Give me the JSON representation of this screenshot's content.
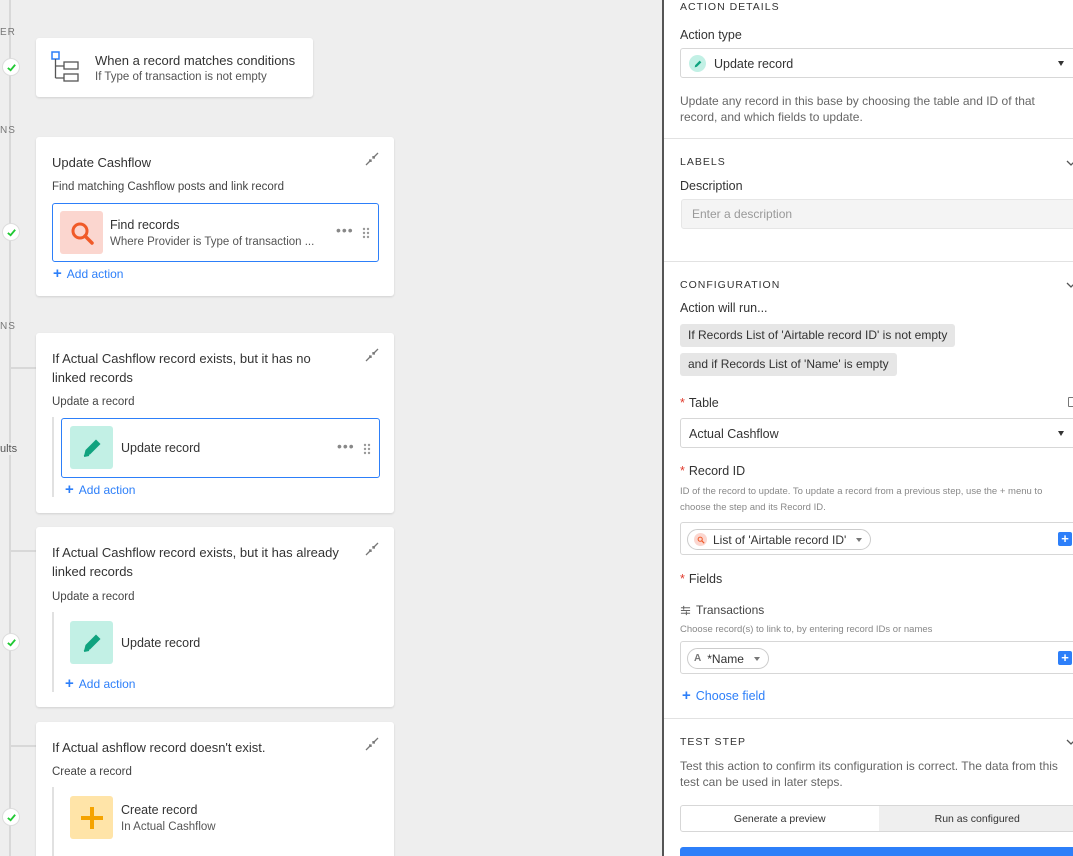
{
  "canvas": {
    "rail_labels": [
      "ER",
      "NS",
      "NS"
    ],
    "side_label_results": "ults",
    "trigger": {
      "title": "When a record matches conditions",
      "subtitle": "If Type of transaction is not empty"
    },
    "groups": [
      {
        "title": "Update Cashflow",
        "subtitle": "Find matching Cashflow posts and link record",
        "action": {
          "title": "Find records",
          "subtitle": "Where Provider is Type of transaction ...",
          "icon": "search-icon"
        },
        "add_action": "Add action"
      },
      {
        "title": "If Actual Cashflow record exists, but it has no linked records",
        "subtitle": "Update a record",
        "action": {
          "title": "Update record",
          "icon": "pencil-icon"
        },
        "add_action": "Add action"
      },
      {
        "title": "If Actual Cashflow record exists, but it has already linked records",
        "subtitle": "Update a record",
        "action": {
          "title": "Update record",
          "icon": "pencil-icon"
        },
        "add_action": "Add action"
      },
      {
        "title": "If Actual ashflow record doesn't exist.",
        "subtitle": "Create a record",
        "action": {
          "title": "Create record",
          "subtitle": "In Actual Cashflow",
          "icon": "plus-icon"
        },
        "add_action": "Add action"
      }
    ]
  },
  "panel": {
    "action_details": {
      "heading": "ACTION DETAILS",
      "action_type_label": "Action type",
      "action_type_value": "Update record",
      "description": "Update any record in this base by choosing the table and ID of that record, and which fields to update."
    },
    "labels": {
      "heading": "LABELS",
      "description_label": "Description",
      "description_placeholder": "Enter a description"
    },
    "configuration": {
      "heading": "CONFIGURATION",
      "will_run": "Action will run...",
      "conditions": [
        "If Records List of 'Airtable record ID' is not empty",
        "and if Records List of 'Name' is empty"
      ],
      "table_label": "Table",
      "table_value": "Actual Cashflow",
      "record_id_label": "Record ID",
      "record_id_help": "ID of the record to update. To update a record from a previous step, use the + menu to choose the step and its Record ID.",
      "record_id_token": "List of 'Airtable record ID'",
      "fields_label": "Fields",
      "field_name": "Transactions",
      "field_help": "Choose record(s) to link to, by entering record IDs or names",
      "field_token": "*Name",
      "choose_field": "Choose field"
    },
    "test_step": {
      "heading": "TEST STEP",
      "description": "Test this action to confirm its configuration is correct. The data from this test can be used in later steps.",
      "option_preview": "Generate a preview",
      "option_run": "Run as configured"
    }
  },
  "colors": {
    "accent": "#2d7ff9",
    "success": "#20c933",
    "required": "#e0392b"
  }
}
